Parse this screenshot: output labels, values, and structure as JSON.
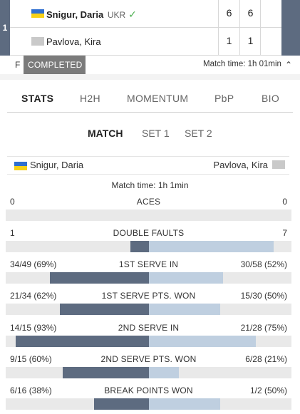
{
  "match": {
    "seed": "1",
    "players": [
      {
        "name": "Snigur, Daria",
        "country": "UKR",
        "flag": "ukr",
        "winner": true,
        "sets": [
          "6",
          "6"
        ]
      },
      {
        "name": "Pavlova, Kira",
        "country": "",
        "flag": "none",
        "winner": false,
        "sets": [
          "1",
          "1"
        ]
      }
    ],
    "status_letter": "F",
    "status": "COMPLETED",
    "match_time": "Match time: 1h 01min"
  },
  "tabs": [
    "STATS",
    "H2H",
    "MOMENTUM",
    "PbP",
    "BIO"
  ],
  "active_tab": "STATS",
  "subtabs": [
    "MATCH",
    "SET 1",
    "SET 2"
  ],
  "active_subtab": "MATCH",
  "stats_header": {
    "left_player": "Snigur, Daria",
    "right_player": "Pavlova, Kira",
    "match_time": "Match time: 1h 1min"
  },
  "stats": [
    {
      "label": "ACES",
      "left": "0",
      "right": "0",
      "left_pct": 0,
      "right_pct": 0
    },
    {
      "label": "DOUBLE FAULTS",
      "left": "1",
      "right": "7",
      "left_pct": 0.125,
      "right_pct": 0.875
    },
    {
      "label": "1ST SERVE IN",
      "left": "34/49 (69%)",
      "right": "30/58 (52%)",
      "left_pct": 0.69,
      "right_pct": 0.52
    },
    {
      "label": "1ST SERVE PTS. WON",
      "left": "21/34 (62%)",
      "right": "15/30 (50%)",
      "left_pct": 0.62,
      "right_pct": 0.5
    },
    {
      "label": "2ND SERVE IN",
      "left": "14/15 (93%)",
      "right": "21/28 (75%)",
      "left_pct": 0.93,
      "right_pct": 0.75
    },
    {
      "label": "2ND SERVE PTS. WON",
      "left": "9/15 (60%)",
      "right": "6/28 (21%)",
      "left_pct": 0.6,
      "right_pct": 0.21
    },
    {
      "label": "BREAK POINTS WON",
      "left": "6/16 (38%)",
      "right": "1/2 (50%)",
      "left_pct": 0.38,
      "right_pct": 0.5
    }
  ],
  "icons": {
    "winner": "check-icon",
    "expand": "chevron-up-icon",
    "flag_ukr": "ukraine-flag-icon",
    "flag_none": "placeholder-flag-icon"
  },
  "colors": {
    "left_bar": "#5d6b80",
    "right_bar": "#bfcfe0",
    "track": "#e9e9e9",
    "accent": "#5d6b80",
    "winner_check": "#4caf50"
  }
}
